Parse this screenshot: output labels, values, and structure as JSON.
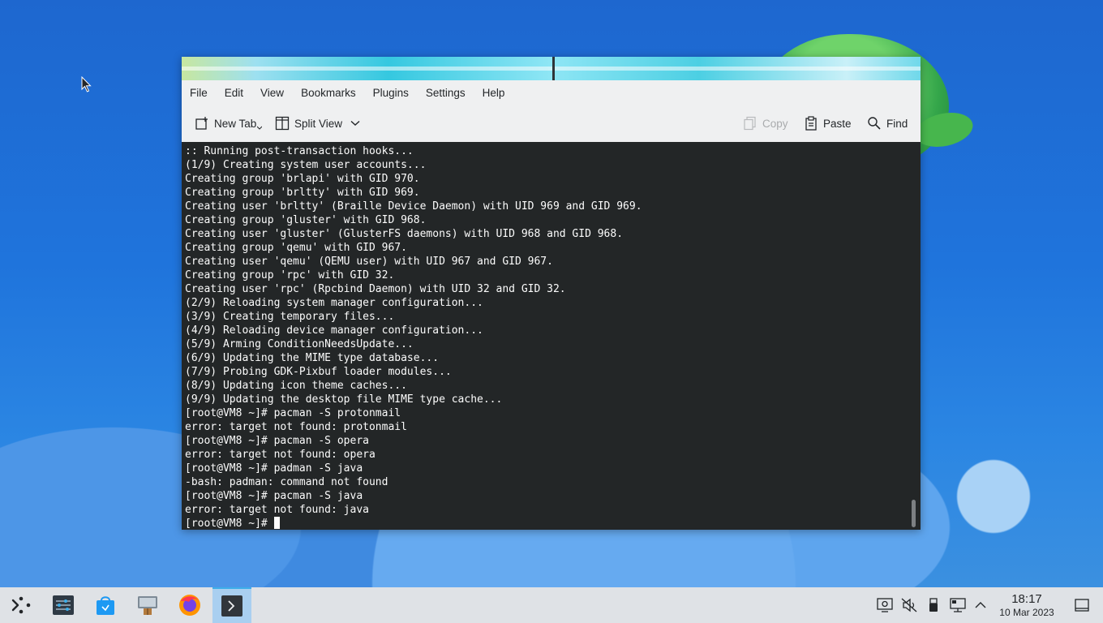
{
  "window": {
    "menu": [
      "File",
      "Edit",
      "View",
      "Bookmarks",
      "Plugins",
      "Settings",
      "Help"
    ],
    "toolbar": {
      "new_tab": "New Tab",
      "split_view": "Split View",
      "copy": "Copy",
      "paste": "Paste",
      "find": "Find"
    }
  },
  "terminal": {
    "lines": [
      ":: Running post-transaction hooks...",
      "(1/9) Creating system user accounts...",
      "Creating group 'brlapi' with GID 970.",
      "Creating group 'brltty' with GID 969.",
      "Creating user 'brltty' (Braille Device Daemon) with UID 969 and GID 969.",
      "Creating group 'gluster' with GID 968.",
      "Creating user 'gluster' (GlusterFS daemons) with UID 968 and GID 968.",
      "Creating group 'qemu' with GID 967.",
      "Creating user 'qemu' (QEMU user) with UID 967 and GID 967.",
      "Creating group 'rpc' with GID 32.",
      "Creating user 'rpc' (Rpcbind Daemon) with UID 32 and GID 32.",
      "(2/9) Reloading system manager configuration...",
      "(3/9) Creating temporary files...",
      "(4/9) Reloading device manager configuration...",
      "(5/9) Arming ConditionNeedsUpdate...",
      "(6/9) Updating the MIME type database...",
      "(7/9) Probing GDK-Pixbuf loader modules...",
      "(8/9) Updating icon theme caches...",
      "(9/9) Updating the desktop file MIME type cache...",
      "[root@VM8 ~]# pacman -S protonmail",
      "error: target not found: protonmail",
      "[root@VM8 ~]# pacman -S opera",
      "error: target not found: opera",
      "[root@VM8 ~]# padman -S java",
      "-bash: padman: command not found",
      "[root@VM8 ~]# pacman -S java",
      "error: target not found: java"
    ],
    "prompt": "[root@VM8 ~]# "
  },
  "taskbar": {
    "time": "18:17",
    "date": "10 Mar 2023"
  }
}
